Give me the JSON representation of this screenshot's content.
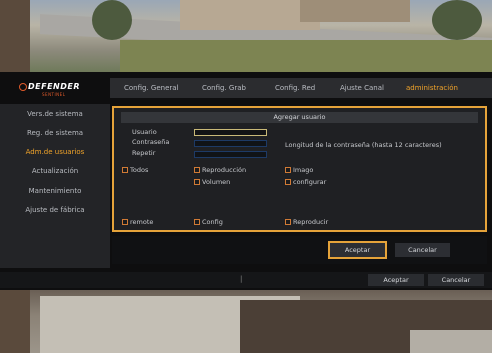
{
  "logo": {
    "brand": "DEFENDER",
    "tagline": "SENTINEL"
  },
  "tabs": [
    {
      "label": "Config. General",
      "active": false
    },
    {
      "label": "Config. Grab",
      "active": false
    },
    {
      "label": "Config. Red",
      "active": false
    },
    {
      "label": "Ajuste Canal",
      "active": false
    },
    {
      "label": "administración",
      "active": true
    }
  ],
  "sidebar": {
    "items": [
      {
        "label": "Vers.de sistema",
        "active": false
      },
      {
        "label": "Reg. de sistema",
        "active": false
      },
      {
        "label": "Adm.de usuarios",
        "active": true
      },
      {
        "label": "Actualización",
        "active": false
      },
      {
        "label": "Mantenimiento",
        "active": false
      },
      {
        "label": "Ajuste de fábrica",
        "active": false
      }
    ]
  },
  "dialog": {
    "title": "Agregar usuario",
    "fields": {
      "user_label": "Usuario",
      "user_value": "",
      "password_label": "Contraseña",
      "password_value": "",
      "repeat_label": "Repetir",
      "repeat_value": ""
    },
    "password_hint": "Longitud de la contraseña (hasta 12 caracteres)",
    "permissions": {
      "todos": "Todos",
      "reproduccion": "Reproducción",
      "imago": "Imago",
      "volumen": "Volumen",
      "configurar": "configurar",
      "remote": "remote",
      "config": "Config",
      "reproducir": "Reproducir"
    }
  },
  "dialog_buttons": {
    "accept": "Aceptar",
    "cancel": "Cancelar"
  },
  "footer": {
    "separator": "|",
    "accept": "Aceptar",
    "cancel": "Cancelar"
  },
  "colors": {
    "accent": "#f0a32a",
    "highlight": "#e5a33a",
    "checkbox": "#d07a35"
  }
}
